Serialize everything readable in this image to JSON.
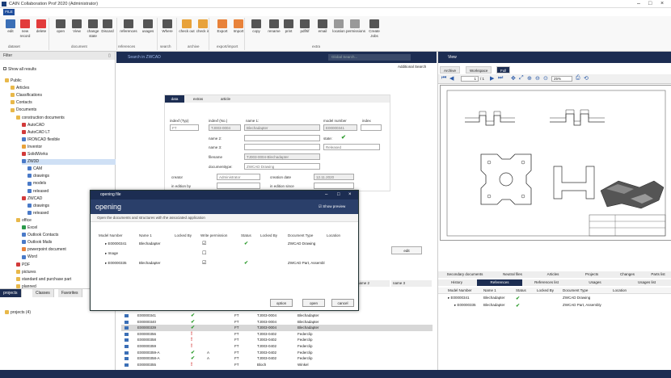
{
  "window": {
    "title": "CAIN Collaboration Prof 2020 (Administrator)",
    "file_menu": "FILE"
  },
  "ribbon": {
    "buttons": [
      {
        "label": "edit",
        "color": "#3b6fb6"
      },
      {
        "label": "new record",
        "color": "#e23b3b"
      },
      {
        "label": "delete",
        "color": "#e23b3b"
      },
      {
        "label": "open",
        "color": "#555555"
      },
      {
        "label": "View",
        "color": "#555555"
      },
      {
        "label": "change state",
        "color": "#555555"
      },
      {
        "label": "Discard",
        "color": "#555555"
      },
      {
        "label": "references",
        "color": "#555555"
      },
      {
        "label": "usages",
        "color": "#555555"
      },
      {
        "label": "Where",
        "color": "#555555"
      },
      {
        "label": "check out",
        "color": "#e8a23a"
      },
      {
        "label": "check in",
        "color": "#e8a23a"
      },
      {
        "label": "Export",
        "color": "#e8823a"
      },
      {
        "label": "Import",
        "color": "#e8823a"
      },
      {
        "label": "copy",
        "color": "#555555"
      },
      {
        "label": "rename",
        "color": "#555555"
      },
      {
        "label": "print",
        "color": "#555555"
      },
      {
        "label": "pdf/tif",
        "color": "#555555"
      },
      {
        "label": "email",
        "color": "#555555"
      },
      {
        "label": "location",
        "color": "#999999"
      },
      {
        "label": "permissions",
        "color": "#999999"
      },
      {
        "label": "Create Jobs",
        "color": "#555555"
      }
    ],
    "groups": [
      "dataset",
      "document",
      "references",
      "search",
      "archive",
      "export/import",
      "extra"
    ]
  },
  "filter": {
    "title": "Filter",
    "show_all": "Show all results",
    "tree": [
      {
        "label": "Public",
        "level": 0,
        "color": "#e8b84a"
      },
      {
        "label": "Articles",
        "level": 1,
        "color": "#e8b84a"
      },
      {
        "label": "Classifications",
        "level": 1,
        "color": "#e8b84a"
      },
      {
        "label": "Contacts",
        "level": 1,
        "color": "#e8b84a"
      },
      {
        "label": "Documents",
        "level": 1,
        "color": "#e8b84a"
      },
      {
        "label": "construction documents",
        "level": 2,
        "color": "#e8b84a"
      },
      {
        "label": "AutoCAD",
        "level": 3,
        "color": "#d23a3a"
      },
      {
        "label": "AutoCAD LT",
        "level": 3,
        "color": "#d23a3a"
      },
      {
        "label": "IRONCAD flexible",
        "level": 3,
        "color": "#4a7ac8"
      },
      {
        "label": "Inventor",
        "level": 3,
        "color": "#e8a23a"
      },
      {
        "label": "SolidWorks",
        "level": 3,
        "color": "#d23a3a"
      },
      {
        "label": "ZW3D",
        "level": 3,
        "color": "#4a7ac8"
      },
      {
        "label": "CAM",
        "level": 4,
        "color": "#4a7ac8"
      },
      {
        "label": "drawings",
        "level": 4,
        "color": "#4a7ac8"
      },
      {
        "label": "models",
        "level": 4,
        "color": "#4a7ac8"
      },
      {
        "label": "released",
        "level": 4,
        "color": "#4a7ac8"
      },
      {
        "label": "ZWCAD",
        "level": 3,
        "color": "#d23a3a"
      },
      {
        "label": "drawings",
        "level": 4,
        "color": "#4a7ac8"
      },
      {
        "label": "released",
        "level": 4,
        "color": "#4a7ac8"
      },
      {
        "label": "office",
        "level": 2,
        "color": "#e8b84a"
      },
      {
        "label": "Excel",
        "level": 3,
        "color": "#2a9a4a"
      },
      {
        "label": "Outlook Contacts",
        "level": 3,
        "color": "#4a7ac8"
      },
      {
        "label": "Outlook Mails",
        "level": 3,
        "color": "#4a7ac8"
      },
      {
        "label": "powerpoint document",
        "level": 3,
        "color": "#e8823a"
      },
      {
        "label": "Word",
        "level": 3,
        "color": "#4a7ac8"
      },
      {
        "label": "PDF",
        "level": 2,
        "color": "#d23a3a"
      },
      {
        "label": "pictures",
        "level": 2,
        "color": "#e8b84a"
      },
      {
        "label": "standard and purchase part",
        "level": 2,
        "color": "#e8b84a"
      },
      {
        "label": "planned",
        "level": 2,
        "color": "#e8b84a"
      },
      {
        "label": "Mails",
        "level": 1,
        "color": "#e8b84a"
      }
    ],
    "bottom_tabs": [
      "projects",
      "Classes",
      "Favorites"
    ],
    "projects_item": "projects (4)"
  },
  "search": {
    "header": "Search in ZWCAD",
    "global_placeholder": "Global Search...",
    "additional": "Additional Search",
    "tabs": [
      "data",
      "extras",
      "article"
    ],
    "fields": {
      "indexftype_label": "indexf (Typ)",
      "indexftype_value": "FT",
      "indexfno_label": "indexf (No.)",
      "indexfno_value": "TJ003-0004",
      "name1_label": "name 1:",
      "name1_value": "Blechadapter",
      "modelnumber_label": "model number",
      "modelnumber_value": "E00000341",
      "index_label": "index",
      "name2_label": "name 2:",
      "state_label": "state:",
      "name3_label": "name 3:",
      "state_value": "Released",
      "filename_label": "filename",
      "filename_value": "TJ003-0004-Blechadapter",
      "doctype_label": "documenttype:",
      "doctype_value": "ZWCAD Drawing",
      "creator_label": "creator",
      "creator_value": "Administrator",
      "createdate_label": "creation date",
      "createdate_value": "12.11.2020",
      "editedby_label": "in edition by",
      "editedate_label": "in edition since",
      "edit_button": "edit"
    }
  },
  "dialog": {
    "window_title": "opening file",
    "heading": "opening",
    "show_preview": "Show preview",
    "info": "Open the documents and structures with the associated application",
    "columns": [
      "Model Number",
      "Name 1",
      "Locked By",
      "Write permission",
      "Status",
      "Locked By",
      "Document Type",
      "Location"
    ],
    "rows": [
      {
        "model": "E00000341",
        "name": "Blechadapter",
        "write": "yes",
        "status": "ok",
        "doctype": "ZWCAD Drawing"
      },
      {
        "model": "Image",
        "name": "",
        "write": "no",
        "status": "",
        "doctype": ""
      },
      {
        "model": "E00000335",
        "name": "Blechadapter",
        "write": "yes",
        "status": "ok",
        "doctype": "ZWCAD Part, Assembl"
      }
    ],
    "buttons": [
      "option",
      "open",
      "cancel"
    ]
  },
  "view": {
    "header": "View",
    "tabs": [
      "Archive",
      "Workspace",
      "Full"
    ],
    "page_current": "1",
    "page_total": "/ 1",
    "zoom": "25%"
  },
  "results": {
    "col_name2": "name 2",
    "col_name3": "name 3",
    "rows": [
      {
        "id": "E00000341",
        "status": "ok",
        "type": "FT",
        "no": "TJ003-0004",
        "name": "Blechadapter"
      },
      {
        "id": "E00000340",
        "status": "ok",
        "type": "FT",
        "no": "TJ003-0004",
        "name": "Blechadapter"
      },
      {
        "id": "E00000339",
        "status": "ok",
        "type": "FT",
        "no": "TJ003-0004",
        "name": "Blechadapter"
      },
      {
        "id": "E00000356",
        "status": "warn",
        "type": "FT",
        "no": "TJ003-0402",
        "name": "Federclip"
      },
      {
        "id": "E00000358",
        "status": "warn",
        "type": "FT",
        "no": "TJ003-0402",
        "name": "Federclip"
      },
      {
        "id": "E00000359",
        "status": "warn",
        "type": "FT",
        "no": "TJ003-0402",
        "name": "Federclip"
      },
      {
        "id": "E00000359-A",
        "status": "ok",
        "mark": "A",
        "type": "FT",
        "no": "TJ003-0402",
        "name": "Federclip"
      },
      {
        "id": "E00000358-A",
        "status": "ok",
        "mark": "A",
        "type": "FT",
        "no": "TJ003-0402",
        "name": "Federclip"
      },
      {
        "id": "E00000355",
        "status": "warn",
        "type": "FT",
        "no": "Bloch",
        "name": "Winkel"
      }
    ]
  },
  "references": {
    "tabs_top": [
      "Secondary documents",
      "Neutral files",
      "Articles",
      "Projects",
      "Changes",
      "Parts list"
    ],
    "tabs_bottom": [
      "History",
      "References",
      "References list",
      "Usages",
      "Usages list"
    ],
    "columns": [
      "Model Number",
      "Name 1",
      "Status",
      "Locked By",
      "Document Type",
      "Location"
    ],
    "rows": [
      {
        "model": "E00000341",
        "name": "Blechadapter",
        "status": "ok",
        "doctype": "ZWCAD Drawing"
      },
      {
        "model": "E00000335",
        "name": "Blechadapter",
        "status": "ok",
        "doctype": "ZWCAD Part, Assembly"
      }
    ]
  }
}
